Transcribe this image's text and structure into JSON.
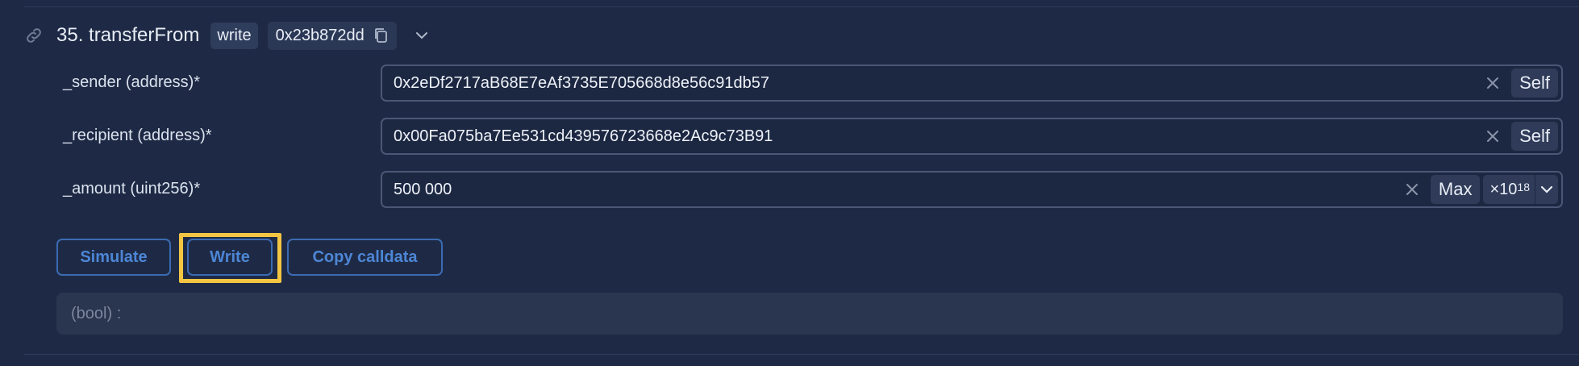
{
  "header": {
    "function_title": "35. transferFrom",
    "type_badge": "write",
    "selector": "0x23b872dd"
  },
  "params": [
    {
      "label": "_sender (address)*",
      "value": "0x2eDf2717aB68E7eAf3735E705668d8e56c91db57",
      "action": "Self"
    },
    {
      "label": "_recipient (address)*",
      "value": "0x00Fa075ba7Ee531cd439576723668e2Ac9c73B91",
      "action": "Self"
    },
    {
      "label": "_amount (uint256)*",
      "value": "500 000",
      "action": "Max",
      "unit_base": "×10",
      "unit_exp": "18"
    }
  ],
  "actions": {
    "simulate": "Simulate",
    "write": "Write",
    "copy_calldata": "Copy calldata"
  },
  "result": {
    "text": "(bool) :"
  },
  "colors": {
    "background": "#1e2a45",
    "accent": "#4d86d6",
    "highlight": "#f4c542"
  }
}
